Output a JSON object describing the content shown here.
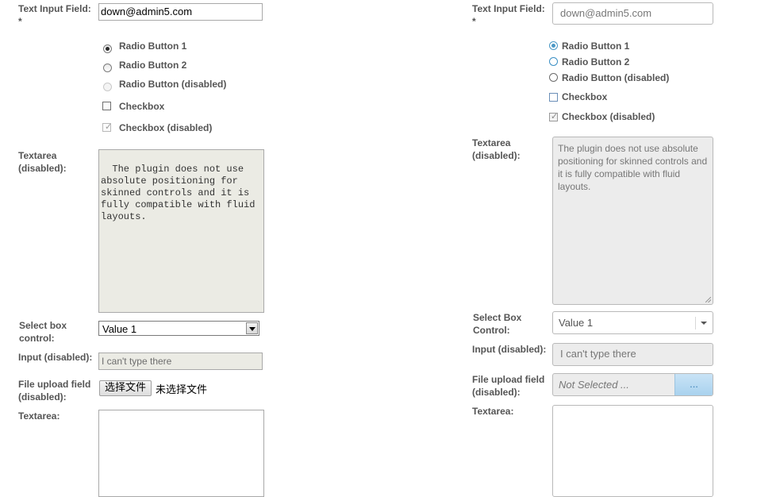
{
  "left": {
    "text_input": {
      "label": "Text Input Field:",
      "required": "*",
      "value": "down@admin5.com"
    },
    "radios": [
      {
        "label": "Radio Button 1"
      },
      {
        "label": "Radio Button 2"
      },
      {
        "label": "Radio Button (disabled)"
      }
    ],
    "checkboxes": [
      {
        "label": "Checkbox"
      },
      {
        "label": "Checkbox (disabled)"
      }
    ],
    "textarea_disabled": {
      "label_line1": "Textarea",
      "label_line2": "(disabled):",
      "value": "The plugin does not use absolute positioning for skinned controls and it is fully compatible with fluid layouts."
    },
    "select": {
      "label_line1": "Select box",
      "label_line2": "control:",
      "value": "Value 1"
    },
    "input_disabled": {
      "label": "Input (disabled):",
      "value": "I can't type there"
    },
    "file_upload": {
      "label_line1": "File upload field",
      "label_line2": "(disabled):",
      "button": "选择文件",
      "status": "未选择文件"
    },
    "textarea": {
      "label": "Textarea:"
    }
  },
  "right": {
    "text_input": {
      "label": "Text Input Field:",
      "required": "*",
      "value": "down@admin5.com"
    },
    "radios": [
      {
        "label": "Radio Button 1"
      },
      {
        "label": "Radio Button 2"
      },
      {
        "label": "Radio Button (disabled)"
      }
    ],
    "checkboxes": [
      {
        "label": "Checkbox"
      },
      {
        "label": "Checkbox (disabled)"
      }
    ],
    "textarea_disabled": {
      "label_line1": "Textarea",
      "label_line2": "(disabled):",
      "value": "The plugin does not use absolute positioning for skinned controls and it is fully compatible with fluid layouts."
    },
    "select": {
      "label_line1": "Select Box",
      "label_line2": "Control:",
      "value": "Value 1"
    },
    "input_disabled": {
      "label": "Input (disabled):",
      "value": "I can't type there"
    },
    "file_upload": {
      "label_line1": "File upload field",
      "label_line2": "(disabled):",
      "placeholder": "Not Selected ...",
      "button": "..."
    },
    "textarea": {
      "label": "Textarea:"
    }
  },
  "colors": {
    "label_text": "#555555",
    "disabled_bg": "#ebebe4",
    "skin_accent": "#4a98c5",
    "skin_button": "#b8daf2"
  }
}
